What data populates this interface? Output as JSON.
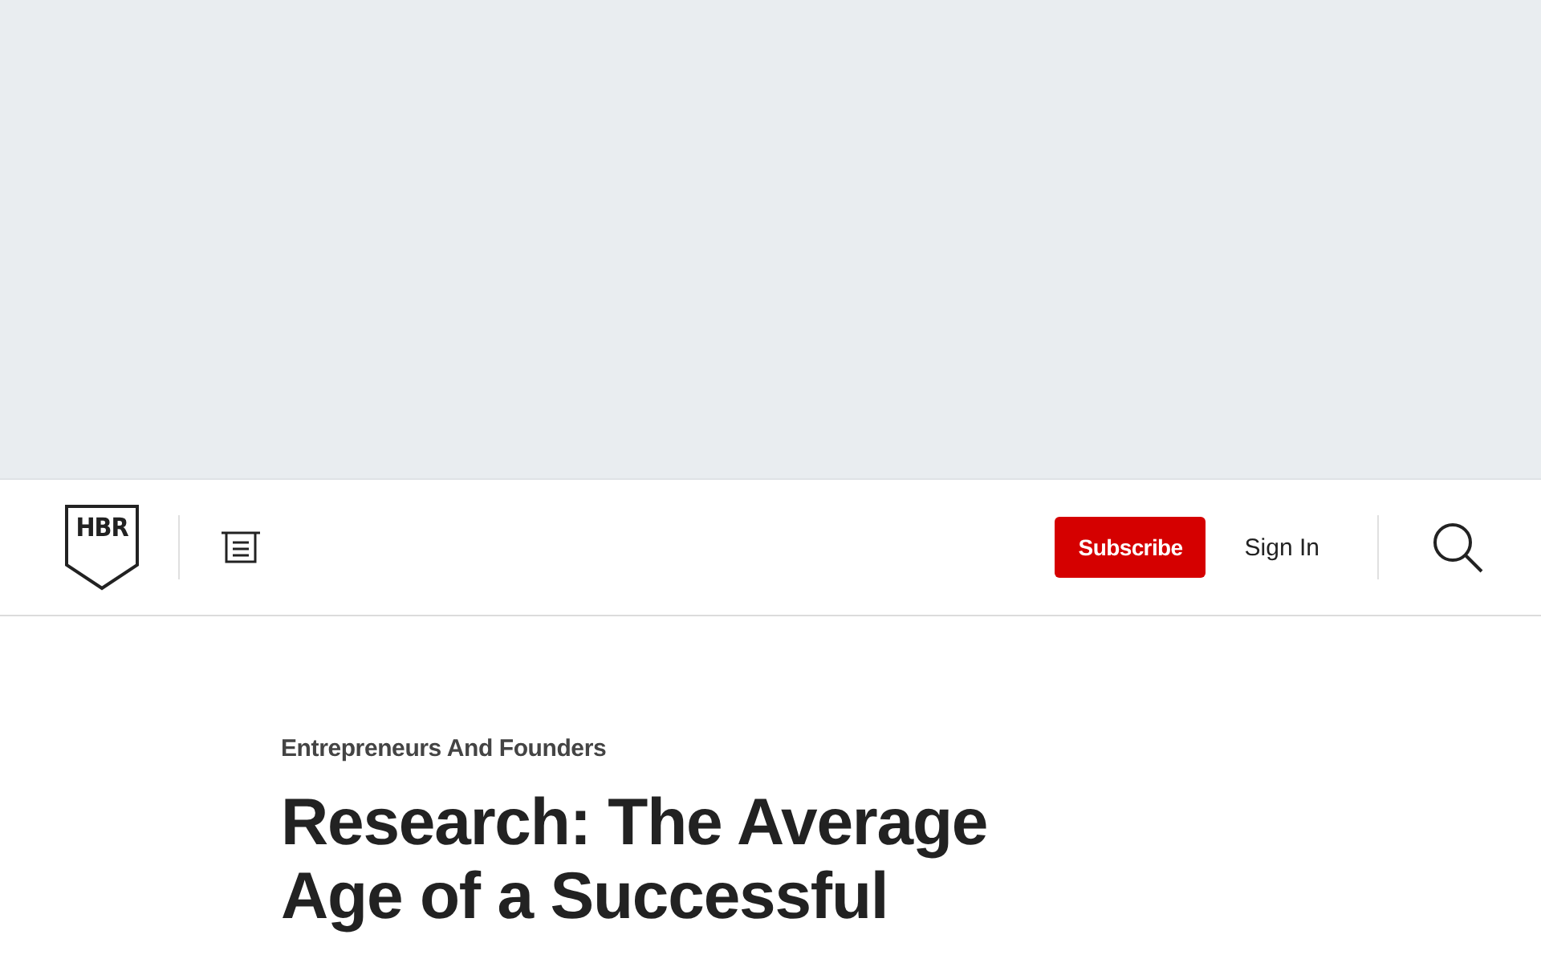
{
  "header": {
    "logo": "HBR",
    "subscribe": "Subscribe",
    "sign_in": "Sign In"
  },
  "article": {
    "topic": "Entrepreneurs And Founders",
    "title": "Research: The Average Age of a Successful"
  }
}
